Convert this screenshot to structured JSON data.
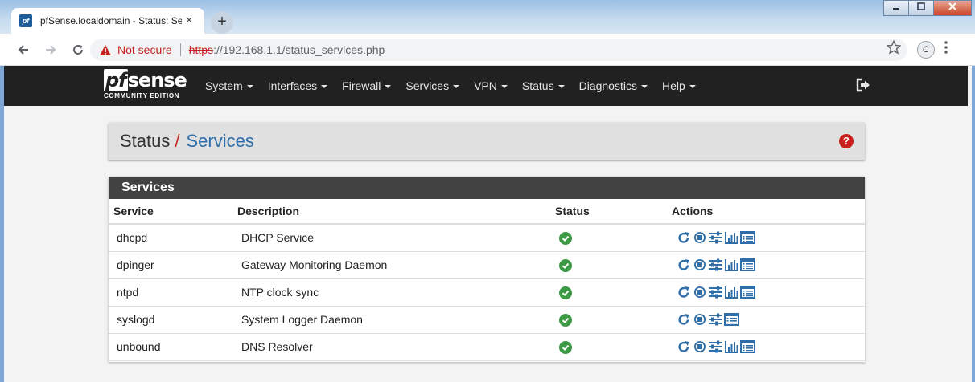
{
  "browser": {
    "tab_title": "pfSense.localdomain - Status: Se",
    "tab_favicon": "pf",
    "close_glyph": "×",
    "newtab_glyph": "+",
    "security_label": "Not secure",
    "url_scheme": "https",
    "url_rest": "://192.168.1.1/status_services.php",
    "profile_initial": "C"
  },
  "logo": {
    "main_a": "pf",
    "main_b": "sense",
    "sub": "COMMUNITY EDITION"
  },
  "menu": {
    "items": [
      {
        "label": "System"
      },
      {
        "label": "Interfaces"
      },
      {
        "label": "Firewall"
      },
      {
        "label": "Services"
      },
      {
        "label": "VPN"
      },
      {
        "label": "Status"
      },
      {
        "label": "Diagnostics"
      },
      {
        "label": "Help"
      }
    ]
  },
  "breadcrumb": {
    "parent": "Status",
    "separator": "/",
    "current": "Services",
    "help_glyph": "?"
  },
  "panel": {
    "title": "Services",
    "columns": {
      "service": "Service",
      "description": "Description",
      "status": "Status",
      "actions": "Actions"
    },
    "rows": [
      {
        "service": "dhcpd",
        "description": "DHCP Service",
        "status": "running",
        "has_graph": true
      },
      {
        "service": "dpinger",
        "description": "Gateway Monitoring Daemon",
        "status": "running",
        "has_graph": true
      },
      {
        "service": "ntpd",
        "description": "NTP clock sync",
        "status": "running",
        "has_graph": true
      },
      {
        "service": "syslogd",
        "description": "System Logger Daemon",
        "status": "running",
        "has_graph": false
      },
      {
        "service": "unbound",
        "description": "DNS Resolver",
        "status": "running",
        "has_graph": true
      }
    ]
  },
  "icons": {
    "back": "arrow-left-icon",
    "forward": "arrow-right-icon",
    "reload": "reload-icon",
    "warning": "warning-triangle-icon",
    "star": "star-icon",
    "kebab": "more-vert-icon",
    "logout": "sign-out-icon",
    "help": "question-circle-icon",
    "status_ok": "check-circle-icon",
    "restart": "restart-icon",
    "stop": "stop-icon",
    "settings": "sliders-icon",
    "graph": "bar-chart-icon",
    "logs": "list-alt-icon"
  },
  "colors": {
    "accent_blue": "#2f6ea8",
    "navbar": "#212121",
    "ok_green": "#3c9a45",
    "danger": "#c9211e"
  }
}
